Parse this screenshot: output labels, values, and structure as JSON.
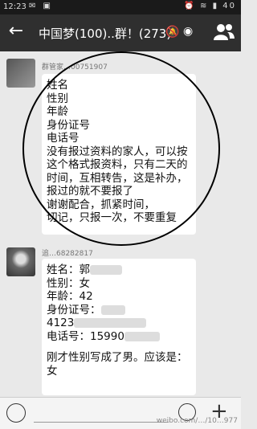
{
  "status_bar": {
    "time": "12:23",
    "battery": "40"
  },
  "header": {
    "title": "中国梦(100)..群！(273)"
  },
  "messages": [
    {
      "nickname": "群管家…00751907",
      "lines": [
        "姓名",
        "性别",
        "年龄",
        "身份证号",
        "电话号",
        "没有报过资料的家人，可以按",
        "这个格式报资料，只有二天的",
        "时间，互相转告，这是补办，",
        "报过的就不要报了",
        "谢谢配合，抓紧时间，",
        "切记，只报一次，不要重复"
      ]
    },
    {
      "nickname": "追…68282817",
      "lines": [
        {
          "label": "姓名：郭",
          "masked": true
        },
        {
          "label": "性别：女"
        },
        {
          "label": "年龄：42"
        },
        {
          "label": "身份证号：",
          "masked": true
        },
        {
          "label": "4123",
          "masked": true
        },
        {
          "label": "电话号：15990",
          "masked": true
        },
        {
          "label": ""
        },
        {
          "label": "刚才性别写成了男。应该是："
        },
        {
          "label": "女"
        }
      ]
    }
  ],
  "input": {
    "placeholder": ""
  },
  "watermark": "weibo.com/…/10…977"
}
